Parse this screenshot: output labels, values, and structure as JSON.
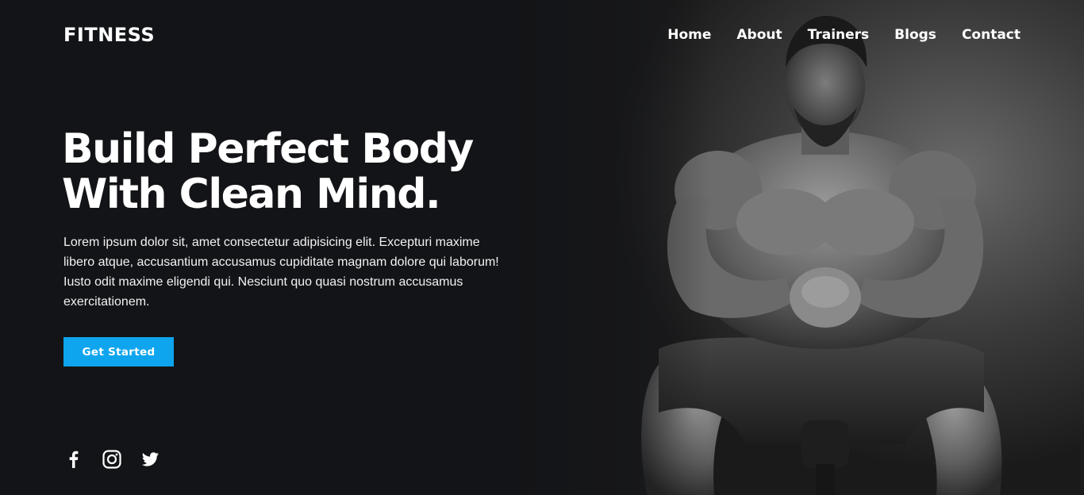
{
  "brand": {
    "logo_text": "FITNESS"
  },
  "nav": {
    "items": [
      {
        "label": "Home"
      },
      {
        "label": "About"
      },
      {
        "label": "Trainers"
      },
      {
        "label": "Blogs"
      },
      {
        "label": "Contact"
      }
    ]
  },
  "hero": {
    "headline_line1": "Build Perfect Body",
    "headline_line2": "With Clean Mind.",
    "description": "Lorem ipsum dolor sit, amet consectetur adipisicing elit. Excepturi maxime libero atque, accusantium accusamus cupiditate magnam dolore qui laborum! Iusto odit maxime eligendi qui. Nesciunt quo quasi nostrum accusamus exercitationem.",
    "cta_label": "Get Started",
    "image_subject": "athlete-portrait"
  },
  "social": {
    "icons": [
      "facebook-icon",
      "instagram-icon",
      "twitter-icon"
    ]
  },
  "colors": {
    "background": "#131417",
    "accent": "#0ea5ee",
    "text": "#ffffff"
  }
}
